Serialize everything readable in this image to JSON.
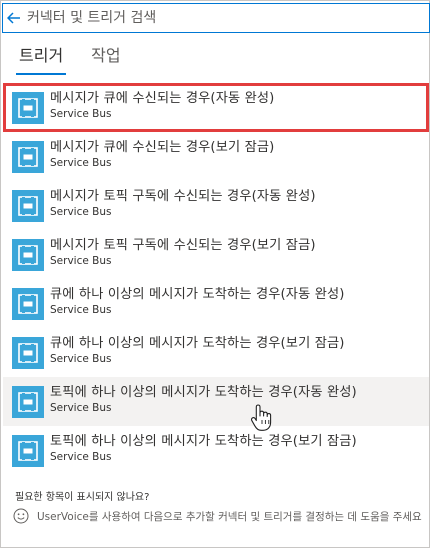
{
  "search": {
    "placeholder": "커넥터 및 트리거 검색"
  },
  "tabs": [
    {
      "label": "트리거",
      "active": true
    },
    {
      "label": "작업",
      "active": false
    }
  ],
  "triggers": [
    {
      "title": "메시지가 큐에 수신되는 경우(자동 완성)",
      "connector": "Service Bus",
      "icon": "service-bus-icon",
      "selected": true
    },
    {
      "title": "메시지가 큐에 수신되는 경우(보기 잠금)",
      "connector": "Service Bus",
      "icon": "service-bus-icon"
    },
    {
      "title": "메시지가 토픽 구독에 수신되는 경우(자동 완성)",
      "connector": "Service Bus",
      "icon": "service-bus-icon"
    },
    {
      "title": "메시지가 토픽 구독에 수신되는 경우(보기 잠금)",
      "connector": "Service Bus",
      "icon": "service-bus-icon"
    },
    {
      "title": "큐에 하나 이상의 메시지가 도착하는 경우(자동 완성)",
      "connector": "Service Bus",
      "icon": "service-bus-icon"
    },
    {
      "title": "큐에 하나 이상의 메시지가 도착하는 경우(보기 잠금)",
      "connector": "Service Bus",
      "icon": "service-bus-icon"
    },
    {
      "title": "토픽에 하나 이상의 메시지가 도착하는 경우(자동 완성)",
      "connector": "Service Bus",
      "icon": "service-bus-icon",
      "hovered": true
    },
    {
      "title": "토픽에 하나 이상의 메시지가 도착하는 경우(보기 잠금)",
      "connector": "Service Bus",
      "icon": "service-bus-icon"
    }
  ],
  "footer": {
    "question": "필요한 항목이 표시되지 않나요?",
    "uservoice": "UserVoice를 사용하여 다음으로 추가할 커넥터 및 트리거를 결정하는 데 도움을 주세요"
  },
  "colors": {
    "accent": "#0078d4",
    "tile": "#3aa6d9",
    "selection": "#e23d3d",
    "hover": "#f3f2f1"
  }
}
